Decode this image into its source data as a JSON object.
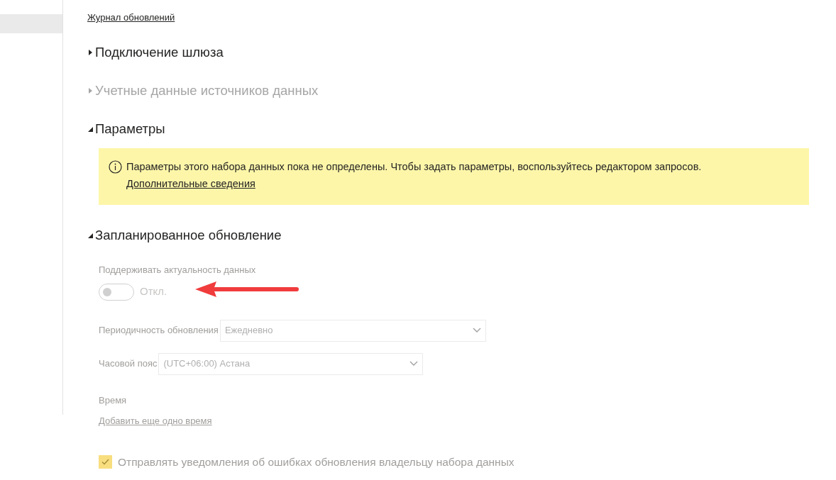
{
  "sidebar": {
    "items": [
      {
        "selected": true
      }
    ]
  },
  "refresh_history_link": "Журнал обновлений",
  "sections": [
    {
      "title": "Подключение шлюза",
      "expanded": false,
      "disabled": false
    },
    {
      "title": "Учетные данные источников данных",
      "expanded": false,
      "disabled": true
    },
    {
      "title": "Параметры",
      "expanded": true,
      "disabled": false,
      "notice": {
        "text": "Параметры этого набора данных пока не определены. Чтобы задать параметры, воспользуйтесь редактором запросов.",
        "link": "Дополнительные сведения"
      }
    },
    {
      "title": "Запланированное обновление",
      "expanded": true,
      "disabled": false,
      "schedule": {
        "keep_up_to_date": {
          "label": "Поддерживать актуальность данных",
          "on": false,
          "state_text": "Откл."
        },
        "frequency": {
          "label": "Периодичность обновления",
          "value": "Ежедневно"
        },
        "timezone": {
          "label": "Часовой пояс",
          "value": "(UTC+06:00) Астана"
        },
        "time": {
          "label": "Время",
          "add_link": "Добавить еще одно время"
        },
        "notify": {
          "label": "Отправлять уведомления об ошибках обновления владельцу набора данных",
          "checked": true
        }
      }
    }
  ]
}
